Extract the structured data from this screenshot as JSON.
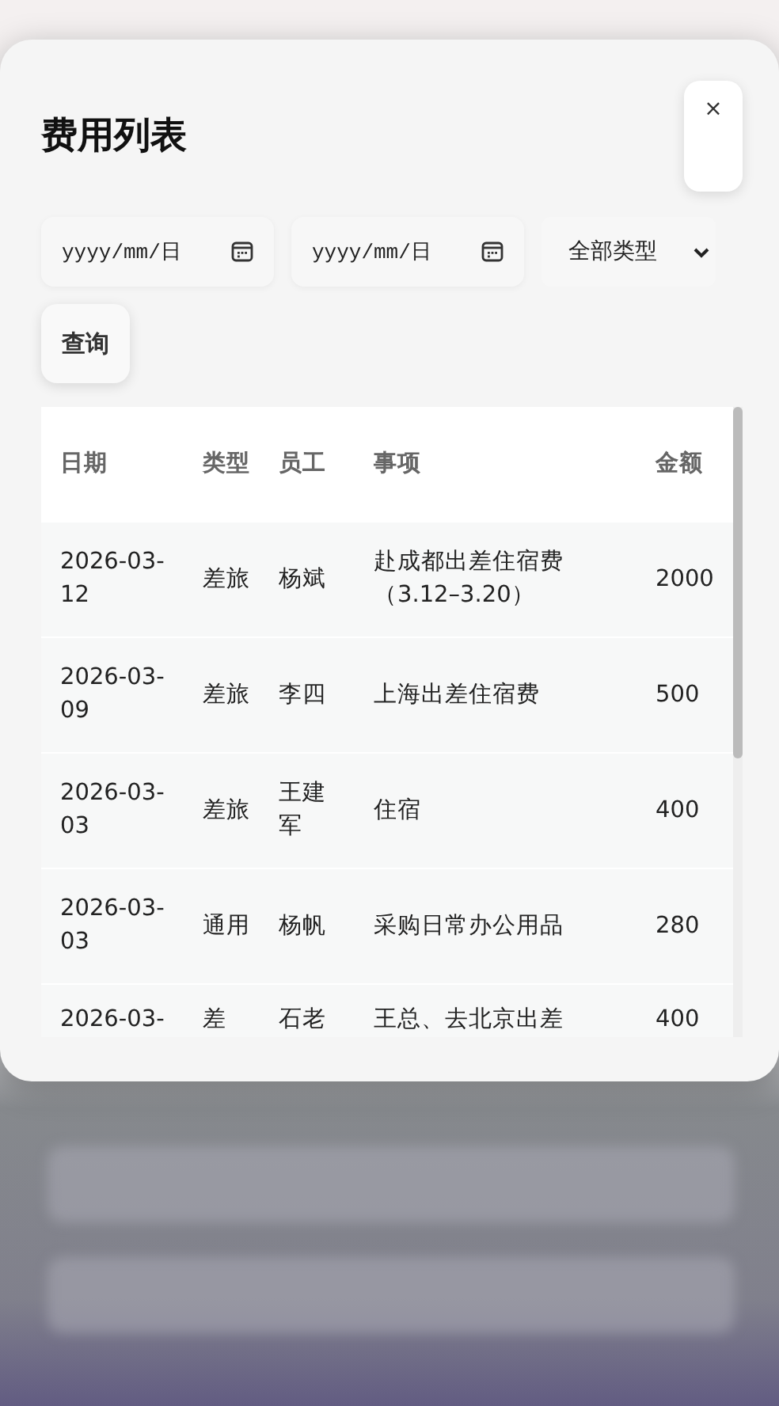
{
  "dialog": {
    "title": "费用列表",
    "close_label": "×"
  },
  "filters": {
    "start_date": {
      "placeholder": "yyyy/mm/日"
    },
    "end_date": {
      "placeholder": "yyyy/mm/日"
    },
    "type_select": {
      "value": "全部类型"
    },
    "query_button": "查询"
  },
  "table": {
    "columns": [
      "日期",
      "类型",
      "员工",
      "事项",
      "金额"
    ],
    "rows": [
      {
        "date": "2026-03-12",
        "type": "差旅",
        "employee": "杨斌",
        "item": "赴成都出差住宿费（3.12–3.20）",
        "amount": "2000"
      },
      {
        "date": "2026-03-09",
        "type": "差旅",
        "employee": "李四",
        "item": "上海出差住宿费",
        "amount": "500"
      },
      {
        "date": "2026-03-03",
        "type": "差旅",
        "employee": "王建军",
        "item": "住宿",
        "amount": "400"
      },
      {
        "date": "2026-03-03",
        "type": "通用",
        "employee": "杨帆",
        "item": "采购日常办公用品",
        "amount": "280"
      },
      {
        "date": "2026-03-",
        "type": "差",
        "employee": "石老",
        "item": "王总、去北京出差",
        "amount": "400"
      }
    ]
  }
}
